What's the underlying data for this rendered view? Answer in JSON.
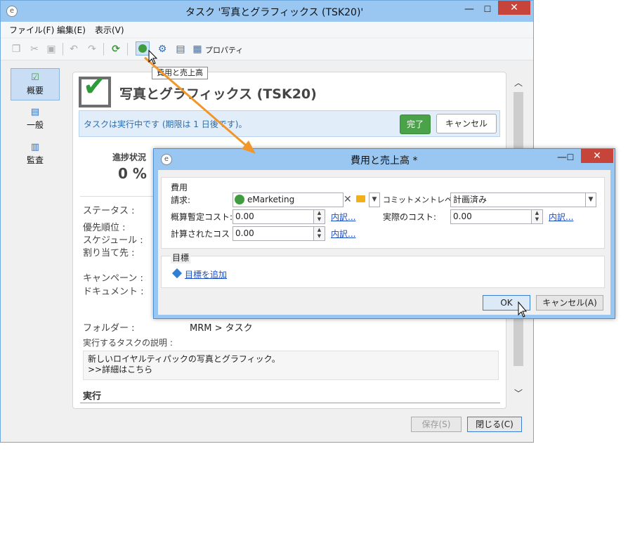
{
  "main_window": {
    "title": "タスク '写真とグラフィックス (TSK20)'",
    "minimize": "—",
    "maximize": "☐",
    "close": "✕"
  },
  "menu": [
    "ファイル(F)",
    "編集(E)",
    "表示(V)"
  ],
  "toolbar": {
    "properties_label": "プロパティ",
    "tooltip": "費用と売上高"
  },
  "nav": [
    {
      "label": "概要",
      "icon": "checklist-icon"
    },
    {
      "label": "一般",
      "icon": "clipboard-icon"
    },
    {
      "label": "監査",
      "icon": "audit-icon"
    }
  ],
  "task": {
    "title": "写真とグラフィックス (TSK20)",
    "status_message": "タスクは実行中です (期限は 1 日後です)。",
    "complete_button": "完了",
    "cancel_button": "キャンセル",
    "progress_label": "進捗状況",
    "progress_value": "0 %",
    "fields": {
      "status": "ステータス :",
      "priority": "優先順位 :",
      "schedule": "スケジュール :",
      "assigned": "割り当て先 :",
      "campaign": "キャンペーン :",
      "document": "ドキュメント :"
    },
    "folder_label": "フォルダー :",
    "folder_value": "MRM > タスク",
    "description_label": "実行するタスクの説明 :",
    "description_line1": "新しいロイヤルティパックの写真とグラフィック。",
    "description_line2": ">>詳細はこちら",
    "execution_header": "実行"
  },
  "bottom_buttons": {
    "save": "保存(S)",
    "close": "閉じる(C)"
  },
  "dialog": {
    "title": "費用と売上高 *",
    "cost_group": "費用",
    "billing_label": "請求:",
    "billing_value": "eMarketing",
    "commitment_label": "コミットメントレベル:",
    "commitment_value": "計画済み",
    "estimated_cost_label": "概算暫定コスト:",
    "estimated_cost_value": "0.00",
    "actual_cost_label": "実際のコスト:",
    "actual_cost_value": "0.00",
    "calculated_cost_label": "計算されたコスト:",
    "calculated_cost_value": "0.00",
    "breakdown_link": "内訳...",
    "goals_group": "目標",
    "add_goal_link": "目標を追加",
    "ok_button": "OK",
    "cancel_button": "キャンセル(A)"
  },
  "colors": {
    "title_bar": "#99c7f2",
    "close_button": "#c7443a",
    "complete_green": "#4aa349",
    "arrow_orange": "#f0962a",
    "link_blue": "#1a4fc4"
  }
}
